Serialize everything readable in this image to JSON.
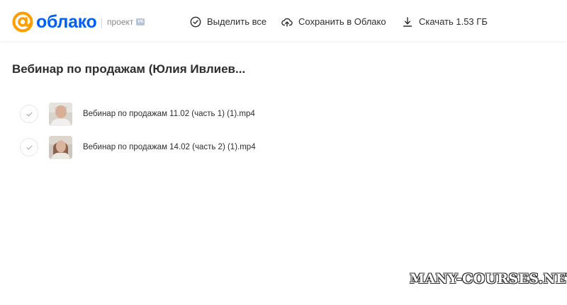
{
  "header": {
    "logo_text": "облако",
    "project_label": "проект",
    "vk_badge": "VK",
    "select_all_label": "Выделить все",
    "save_label": "Сохранить в Облако",
    "download_label": "Скачать 1.53 ГБ"
  },
  "folder": {
    "title": "Вебинар по продажам (Юлия Ивлиев..."
  },
  "files": [
    {
      "name": "Вебинар по продажам 11.02 (часть 1) (1).mp4"
    },
    {
      "name": "Вебинар по продажам 14.02 (часть 2) (1).mp4"
    }
  ],
  "watermark": "MANY-COURSES.NET",
  "colors": {
    "brand_orange": "#ff9e00",
    "brand_blue": "#005ff9",
    "text": "#2c2d2e",
    "muted": "#87898f"
  },
  "icons": {
    "logo": "at-sign-logo",
    "select_all": "check-circle-icon",
    "save": "cloud-upload-icon",
    "download": "download-icon",
    "file_check": "check-icon"
  }
}
